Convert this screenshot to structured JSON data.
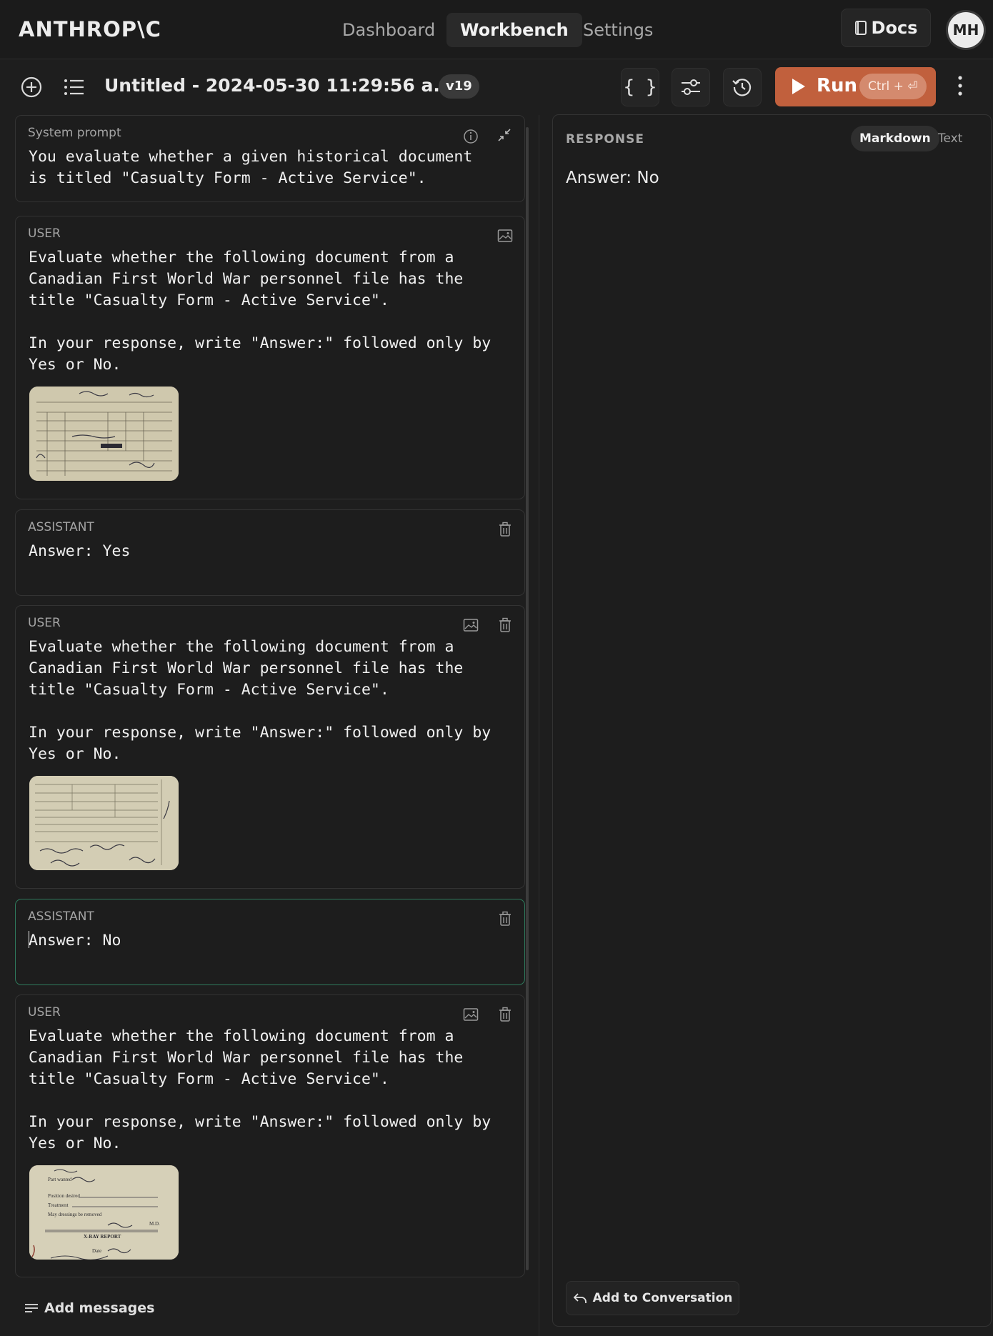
{
  "brand": {
    "logo_text": "ANTHROP\\C"
  },
  "nav": {
    "tabs": [
      {
        "label": "Dashboard",
        "active": false
      },
      {
        "label": "Workbench",
        "active": true
      },
      {
        "label": "Settings",
        "active": false
      }
    ],
    "docs_label": "Docs",
    "avatar_initials": "MH"
  },
  "toolbar": {
    "title": "Untitled - 2024-05-30 11:29:56 a.m.",
    "version": "v19",
    "run_label": "Run",
    "run_shortcut": "Ctrl + ⏎",
    "icons": [
      "plus-circle-icon",
      "list-icon",
      "code-braces-icon",
      "sliders-icon",
      "history-icon",
      "play-icon",
      "more-vertical-icon"
    ]
  },
  "system_prompt": {
    "label": "System prompt",
    "text": "You evaluate whether a given historical document is titled \"Casualty Form - Active Service\"."
  },
  "messages": [
    {
      "role": "USER",
      "text": "Evaluate whether the following document from a Canadian First World War personnel file has the title \"Casualty Form - Active Service\".\n\nIn your response, write \"Answer:\" followed only by Yes or No.",
      "has_image": true
    },
    {
      "role": "ASSISTANT",
      "text": "Answer: Yes"
    },
    {
      "role": "USER",
      "text": "Evaluate whether the following document from a Canadian First World War personnel file has the title \"Casualty Form - Active Service\".\n\nIn your response, write \"Answer:\" followed only by Yes or No.",
      "has_image": true
    },
    {
      "role": "ASSISTANT",
      "text": "Answer: No",
      "focused": true
    },
    {
      "role": "USER",
      "text": "Evaluate whether the following document from a Canadian First World War personnel file has the title \"Casualty Form - Active Service\".\n\nIn your response, write \"Answer:\" followed only by Yes or No.",
      "has_image": true
    }
  ],
  "thumbnails": {
    "third_image_text": {
      "line1": "Part wanted",
      "line2": "Position desired",
      "line3": "Treatment",
      "line4": "May dressings be removed",
      "line5": "M.D.",
      "heading": "X-RAY REPORT",
      "line6": "Date"
    }
  },
  "add_messages_label": "Add messages",
  "response": {
    "header": "RESPONSE",
    "modes": [
      {
        "label": "Markdown",
        "active": true
      },
      {
        "label": "Text",
        "active": false
      }
    ],
    "text": "Answer: No",
    "add_to_conversation_label": "Add to Conversation"
  },
  "colors": {
    "background": "#1e1e1e",
    "run_button": "#c1603d",
    "focused_border": "#2f7a5c"
  }
}
